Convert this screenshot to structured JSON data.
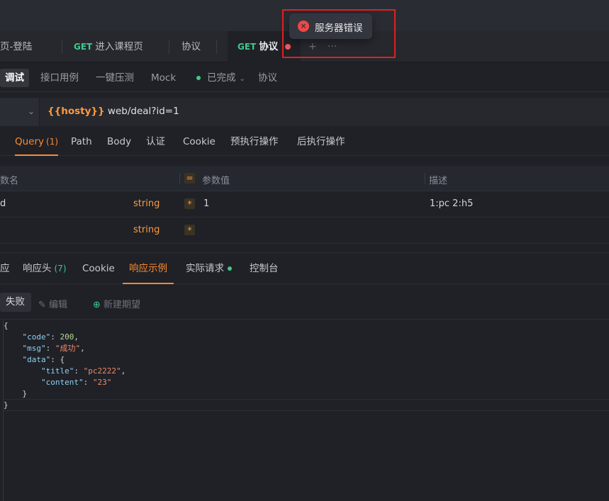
{
  "tabs": [
    {
      "label": "页-登陆",
      "method": ""
    },
    {
      "label": "进入课程页",
      "method": "GET"
    },
    {
      "label": "协议",
      "method": ""
    },
    {
      "label": "协议",
      "method": "GET"
    }
  ],
  "tab_add": "+",
  "tab_more": "···",
  "toolbar": {
    "debug": "调试",
    "cases": "接口用例",
    "stress": "一键压测",
    "mock": "Mock",
    "status": "已完成",
    "protocol": "协议"
  },
  "url": {
    "variable": "{{hosty}}",
    "path": " web/deal?id=1"
  },
  "request_tabs": {
    "query": "Query",
    "query_count": "(1)",
    "path": "Path",
    "body": "Body",
    "auth": "认证",
    "cookie": "Cookie",
    "pre": "预执行操作",
    "post": "后执行操作"
  },
  "params": {
    "headers": {
      "name": "数名",
      "value": "参数值",
      "desc": "描述"
    },
    "eq_symbol": "=",
    "required_symbol": "*",
    "rows": [
      {
        "name": "d",
        "type": "string",
        "value": "1",
        "desc": "1:pc 2:h5"
      },
      {
        "name": "",
        "type": "string",
        "value": "",
        "desc": ""
      }
    ]
  },
  "response_tabs": {
    "response": "应",
    "headers": "响应头",
    "headers_count": "(7)",
    "cookie": "Cookie",
    "example": "响应示例",
    "actual": "实际请求",
    "console": "控制台"
  },
  "example_bar": {
    "fail": "失败",
    "edit": "编辑",
    "new": "新建期望"
  },
  "json_body": {
    "l1": "{",
    "code_key": "\"code\"",
    "code_val": "200",
    "msg_key": "\"msg\"",
    "msg_val": "\"成功\"",
    "data_key": "\"data\"",
    "title_key": "\"title\"",
    "title_val": "\"pc2222\"",
    "content_key": "\"content\"",
    "content_val": "\"23\"",
    "inner_close": "}",
    "outer_close": "}"
  },
  "toast": {
    "message": "服务器错误"
  }
}
